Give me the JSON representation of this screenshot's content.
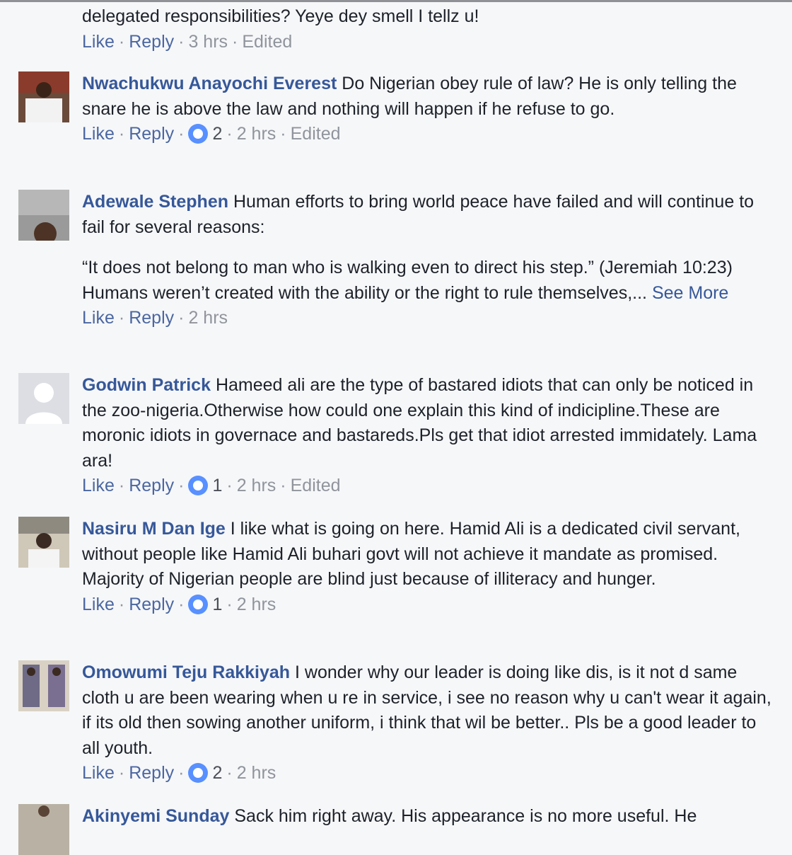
{
  "labels": {
    "like": "Like",
    "reply": "Reply",
    "see_more": "See More",
    "dot": "·"
  },
  "colors": {
    "name_link": "#365899",
    "meta_gray": "#90949c",
    "reaction_blue": "#5890ff"
  },
  "partial_top": {
    "text": "delegated responsibilities? Yeye dey smell I tellz u!",
    "time": "3 hrs",
    "edited": "Edited"
  },
  "comments": [
    {
      "author": "Nwachukwu Anayochi Everest",
      "text": "Do Nigerian obey rule of law? He is only telling the snare he is above the law and nothing will happen if he refuse to go.",
      "reactions": "2",
      "time": "2 hrs",
      "edited": "Edited"
    },
    {
      "author": "Adewale Stephen",
      "text": "Human efforts to bring world peace have failed and will continue to fail for several reasons:",
      "quote": "“It does not belong to man who is walking even to direct his step.” (Jeremiah 10:23) Humans weren’t created with the ability or the right to rule themselves,...",
      "time": "2 hrs"
    },
    {
      "author": "Godwin Patrick",
      "text": "Hameed ali are the type of bastared idiots that can only be noticed in the zoo-nigeria.Otherwise how could one explain this kind of indicipline.These are moronic idiots in governace and bastareds.Pls get that idiot arrested immidately. Lama ara!",
      "reactions": "1",
      "time": "2 hrs",
      "edited": "Edited"
    },
    {
      "author": "Nasiru M Dan Ige",
      "text": "I like what is going on here. Hamid Ali is a dedicated civil servant, without people like Hamid Ali buhari govt will not achieve it mandate as promised. Majority of Nigerian people are blind just because of illiteracy and hunger.",
      "reactions": "1",
      "time": "2 hrs"
    },
    {
      "author": "Omowumi Teju Rakkiyah",
      "text": "I wonder why our leader is doing like dis, is it not d same cloth u are been wearing when u re in service, i see no reason why u can't wear it again, if its old then sowing another uniform, i think that wil be better.. Pls be a good leader to all youth.",
      "reactions": "2",
      "time": "2 hrs"
    }
  ],
  "partial_bottom": {
    "author": "Akinyemi Sunday",
    "text": "Sack him right away. His appearance is no more useful. He"
  }
}
